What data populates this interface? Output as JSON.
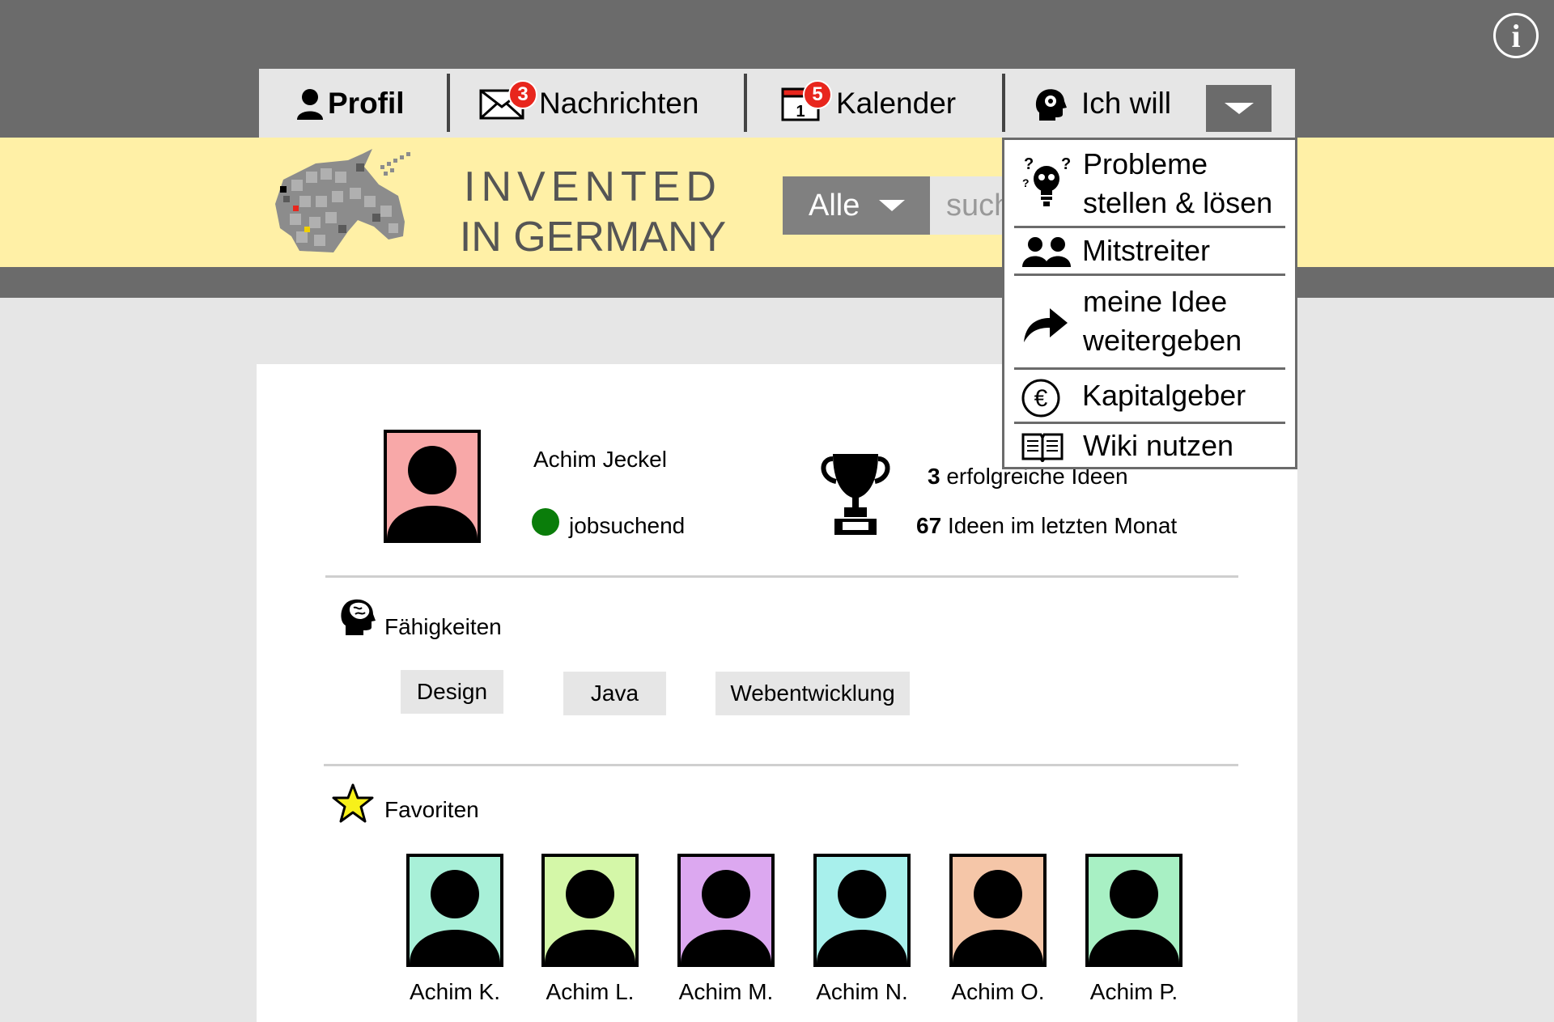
{
  "nav": {
    "profile": "Profil",
    "messages": "Nachrichten",
    "messages_badge": "3",
    "calendar": "Kalender",
    "calendar_day": "1",
    "calendar_badge": "5",
    "want": "Ich will"
  },
  "brand": {
    "line1": "INVENTED",
    "line2": "IN GERMANY"
  },
  "search": {
    "filter": "Alle",
    "placeholder": "such"
  },
  "menu": {
    "items": [
      {
        "line1": "Probleme",
        "line2": "stellen & lösen",
        "icon": "lightbulb-question-icon"
      },
      {
        "line1": "Mitstreiter",
        "icon": "people-icon"
      },
      {
        "line1": "meine Idee",
        "line2": "weitergeben",
        "icon": "share-arrow-icon"
      },
      {
        "line1": "Kapitalgeber",
        "icon": "euro-icon"
      },
      {
        "line1": "Wiki nutzen",
        "icon": "book-icon"
      }
    ]
  },
  "profile": {
    "name": "Achim Jeckel",
    "status": "jobsuchend",
    "status_color": "#0a7d0a",
    "successful_count": "3",
    "successful_label": "erfolgreiche Ideen",
    "monthly_count": "67",
    "monthly_label": "Ideen im letzten Monat"
  },
  "skills": {
    "title": "Fähigkeiten",
    "tags": [
      "Design",
      "Java",
      "Webentwicklung"
    ]
  },
  "favorites": {
    "title": "Favoriten",
    "people": [
      {
        "name": "Achim K.",
        "color": "#a8f0d8"
      },
      {
        "name": "Achim L.",
        "color": "#d4f7a8"
      },
      {
        "name": "Achim M.",
        "color": "#dca8f0"
      },
      {
        "name": "Achim N.",
        "color": "#a8f0ec"
      },
      {
        "name": "Achim O.",
        "color": "#f5c6a8"
      },
      {
        "name": "Achim P.",
        "color": "#a8f0c4"
      }
    ]
  },
  "colors": {
    "topbar": "#6b6b6b",
    "brandbar": "#fff0a6",
    "badge": "#e8261d",
    "profile_avatar": "#f8a8a8"
  }
}
